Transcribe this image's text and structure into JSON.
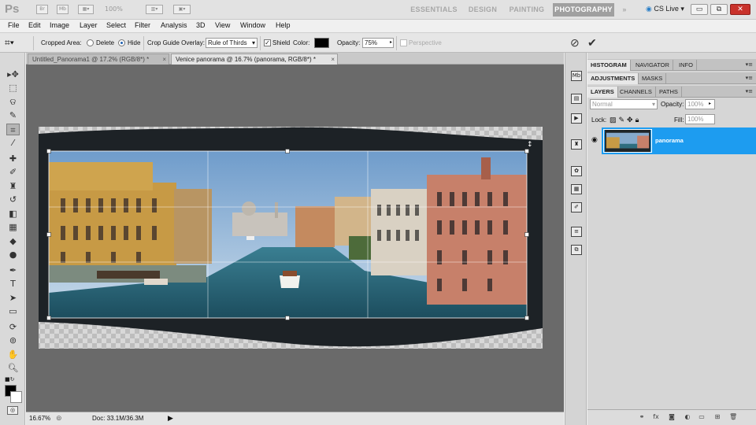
{
  "app": {
    "logo": "Ps",
    "bridge_icon": "Br",
    "minibridge_icon": "Mb",
    "zoom": "100%",
    "workspaces": [
      "ESSENTIALS",
      "DESIGN",
      "PAINTING",
      "PHOTOGRAPHY"
    ],
    "active_workspace": "PHOTOGRAPHY",
    "more_workspaces": "»",
    "cs_live": "CS Live",
    "window_controls": {
      "minimize": "▭",
      "restore": "⧉",
      "close": "✕"
    }
  },
  "menu": [
    "File",
    "Edit",
    "Image",
    "Layer",
    "Select",
    "Filter",
    "Analysis",
    "3D",
    "View",
    "Window",
    "Help"
  ],
  "options": {
    "cropped_area_label": "Cropped Area:",
    "delete_label": "Delete",
    "hide_label": "Hide",
    "cropped_area_value": "Hide",
    "overlay_label": "Crop Guide Overlay:",
    "overlay_value": "Rule of Thirds",
    "shield_label": "Shield",
    "shield_checked": true,
    "color_label": "Color:",
    "shield_color": "#000000",
    "opacity_label": "Opacity:",
    "opacity_value": "75%",
    "perspective_label": "Perspective",
    "cancel_icon": "⊘",
    "commit_icon": "✔"
  },
  "tools": [
    {
      "name": "move-tool-icon",
      "glyph": "▸✥"
    },
    {
      "name": "marquee-tool-icon",
      "glyph": "⬚"
    },
    {
      "name": "lasso-tool-icon",
      "glyph": "ଡ"
    },
    {
      "name": "quick-selection-tool-icon",
      "glyph": "✎"
    },
    {
      "name": "crop-tool-icon",
      "glyph": "⌗"
    },
    {
      "name": "eyedropper-tool-icon",
      "glyph": "⁄"
    },
    {
      "name": "healing-brush-tool-icon",
      "glyph": "✚"
    },
    {
      "name": "brush-tool-icon",
      "glyph": "✐"
    },
    {
      "name": "clone-stamp-tool-icon",
      "glyph": "♜"
    },
    {
      "name": "history-brush-tool-icon",
      "glyph": "↺"
    },
    {
      "name": "eraser-tool-icon",
      "glyph": "◧"
    },
    {
      "name": "gradient-tool-icon",
      "glyph": "▦"
    },
    {
      "name": "blur-tool-icon",
      "glyph": "◆"
    },
    {
      "name": "dodge-tool-icon",
      "glyph": "●"
    },
    {
      "name": "pen-tool-icon",
      "glyph": "✒"
    },
    {
      "name": "type-tool-icon",
      "glyph": "T"
    },
    {
      "name": "path-selection-tool-icon",
      "glyph": "➤"
    },
    {
      "name": "shape-tool-icon",
      "glyph": "▭"
    },
    {
      "name": "3d-rotate-tool-icon",
      "glyph": "⟳"
    },
    {
      "name": "3d-orbit-tool-icon",
      "glyph": "⊚"
    },
    {
      "name": "hand-tool-icon",
      "glyph": "✋"
    },
    {
      "name": "zoom-tool-icon",
      "glyph": "🔍︎"
    }
  ],
  "documents": {
    "tabs": [
      {
        "label": "Untitled_Panorama1 @ 17.2% (RGB/8*) *",
        "active": false
      },
      {
        "label": "Venice panorama @ 16.7% (panorama, RGB/8*) *",
        "active": true
      }
    ],
    "close_glyph": "×"
  },
  "status": {
    "zoom": "16.67%",
    "doc_info": "Doc: 33.1M/36.3M"
  },
  "panels": {
    "group1": [
      "HISTOGRAM",
      "NAVIGATOR",
      "INFO"
    ],
    "group2": [
      "ADJUSTMENTS",
      "MASKS"
    ],
    "group3": [
      "LAYERS",
      "CHANNELS",
      "PATHS"
    ],
    "blend_mode": "Normal",
    "opacity_label": "Opacity:",
    "opacity_value": "100%",
    "lock_label": "Lock:",
    "fill_label": "Fill:",
    "fill_value": "100%",
    "layer_name": "panorama",
    "layer_selected_color": "#1d9cf0"
  },
  "colors": {
    "foreground": "#000000",
    "background": "#ffffff",
    "canvas_bg": "#6a6a6a"
  }
}
